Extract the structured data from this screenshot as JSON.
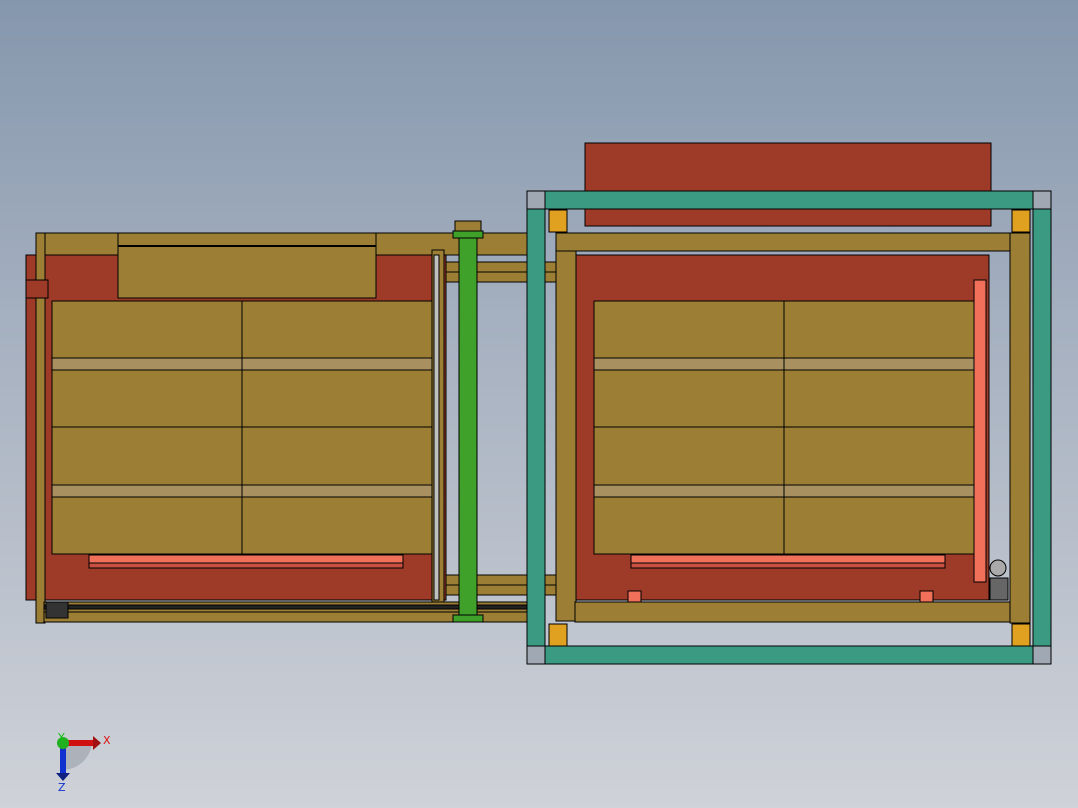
{
  "viewport": {
    "description_free": true,
    "triad": {
      "x_label": "X",
      "y_label": "Y",
      "z_label": "Z"
    }
  },
  "colors": {
    "frame_olive": "#9c7f35",
    "panel_red": "#9e3a28",
    "frame_teal": "#3b9a82",
    "rail_green": "#3fa02a",
    "bar_salmon": "#f0705a",
    "axis_x": "#e01010",
    "axis_y": "#10c010",
    "axis_z": "#1030d0"
  }
}
